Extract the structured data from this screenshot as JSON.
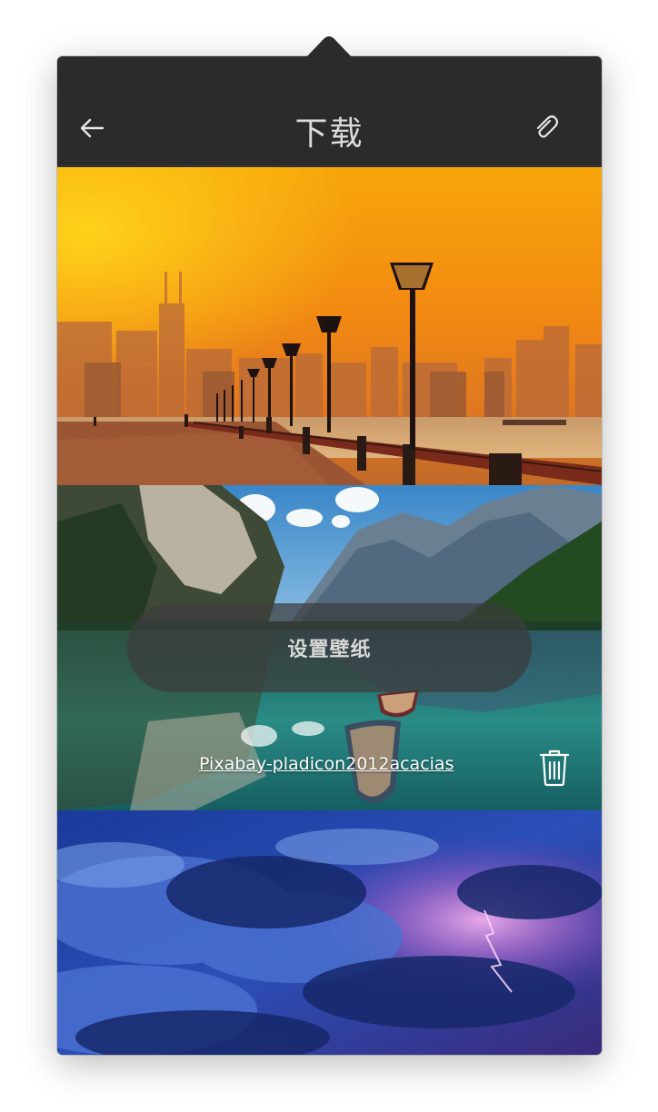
{
  "header": {
    "title": "下载",
    "back_icon": "arrow-left-icon",
    "attach_icon": "paperclip-icon"
  },
  "wallpapers": [
    {
      "scene": "sunset-city-promenade"
    },
    {
      "scene": "mountain-lake-boats",
      "set_wallpaper_label": "设置壁纸",
      "author_label": "Pixabay-pladicon2012acacias",
      "delete_icon": "trash-icon"
    },
    {
      "scene": "storm-clouds"
    }
  ],
  "colors": {
    "popover_bg": "#2b2b2b",
    "title_text": "#dcdcdc"
  }
}
